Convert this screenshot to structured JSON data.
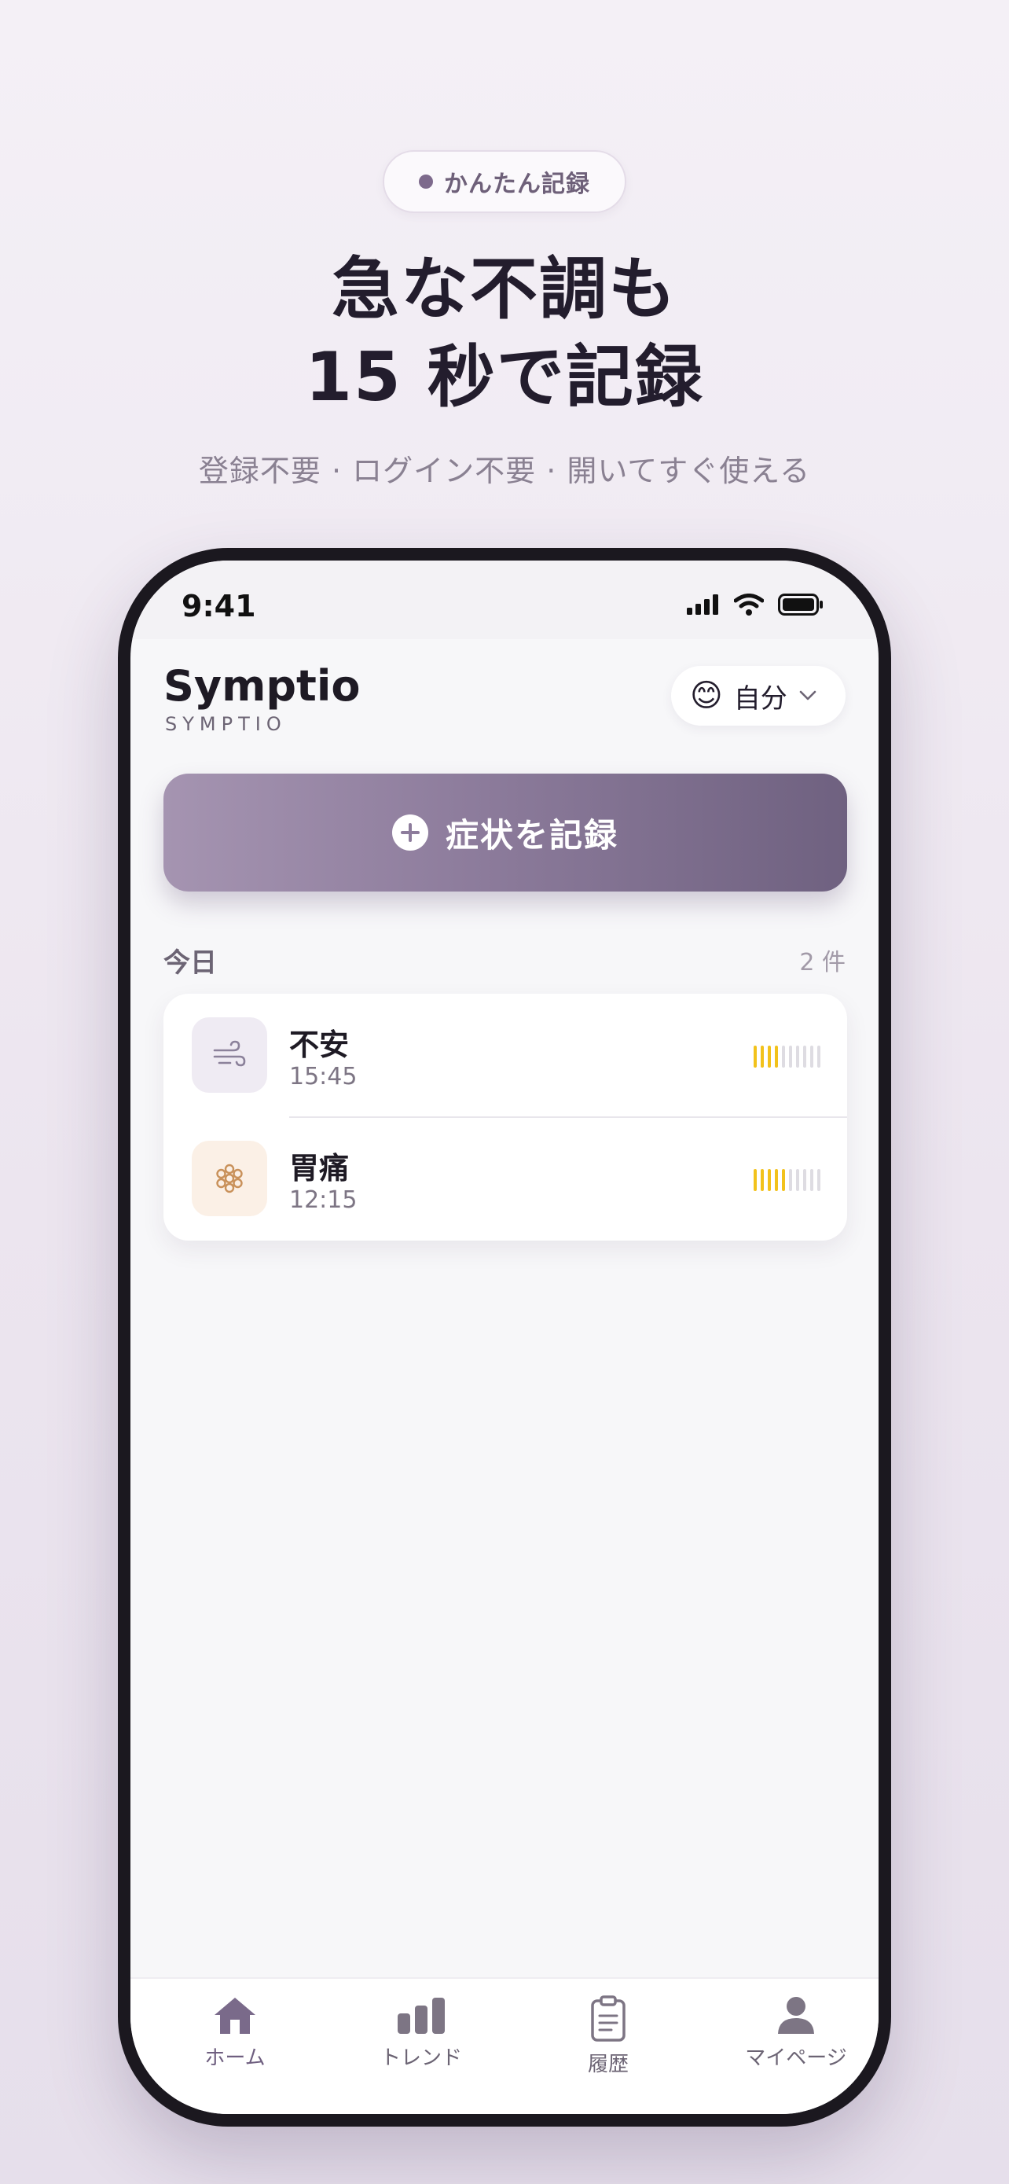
{
  "promo": {
    "badge": "かんたん記録",
    "headline_line1": "急な不調も",
    "headline_line2": "15 秒で記録",
    "subline": "登録不要 · ログイン不要 · 開いてすぐ使える"
  },
  "status_bar": {
    "time": "9:41"
  },
  "app": {
    "title": "Symptio",
    "subtitle": "SYMPTIO",
    "profile": {
      "emoji": "😊",
      "name": "自分"
    },
    "record_button": "症状を記録",
    "section": {
      "label": "今日",
      "count": "2 件"
    },
    "entries": [
      {
        "title": "不安",
        "time": "15:45",
        "icon": "wind-icon",
        "severity": 4,
        "max": 10
      },
      {
        "title": "胃痛",
        "time": "12:15",
        "icon": "flower-icon",
        "severity": 5,
        "max": 10
      }
    ]
  },
  "tabs": [
    {
      "label": "ホーム",
      "icon": "home-icon",
      "active": true
    },
    {
      "label": "トレンド",
      "icon": "bar-chart-icon",
      "active": false
    },
    {
      "label": "履歴",
      "icon": "clipboard-icon",
      "active": false
    },
    {
      "label": "マイページ",
      "icon": "person-icon",
      "active": false
    }
  ],
  "colors": {
    "accent": "#8d7c9c",
    "severity_on": "#f2c21b",
    "severity_off": "#dedce2"
  }
}
